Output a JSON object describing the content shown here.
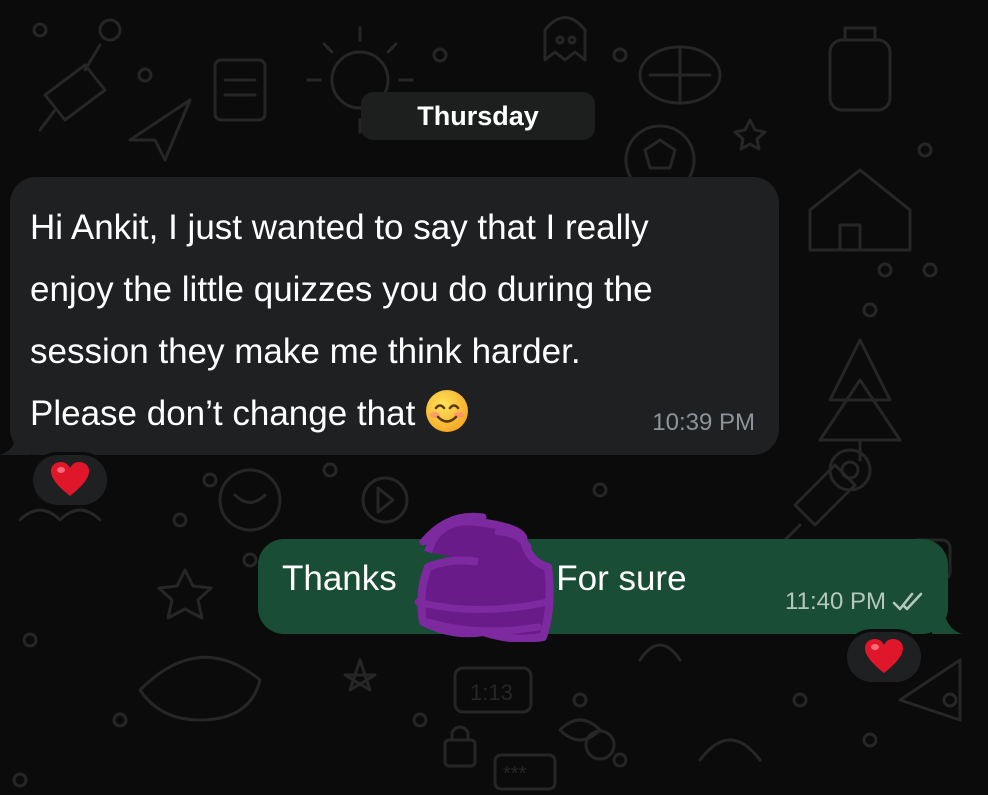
{
  "date_divider": "Thursday",
  "incoming": {
    "lines": [
      "Hi Ankit, I just wanted to say that I really",
      "enjoy the little quizzes you do during the",
      "session they make me think harder.",
      "Please don’t change that"
    ],
    "emoji": "smiling-face-icon",
    "time": "10:39 PM",
    "reaction": "red-heart"
  },
  "outgoing": {
    "text_before": "Thanks",
    "text_after": "! For sure",
    "time": "11:40 PM",
    "status_icon": "double-check-read-icon",
    "reaction": "red-heart"
  },
  "colors": {
    "background": "#0b0b0b",
    "incoming_bubble": "#1f2022",
    "outgoing_bubble": "#1a4d36",
    "heart": "#e0162b",
    "redaction": "#6a1b8a"
  }
}
